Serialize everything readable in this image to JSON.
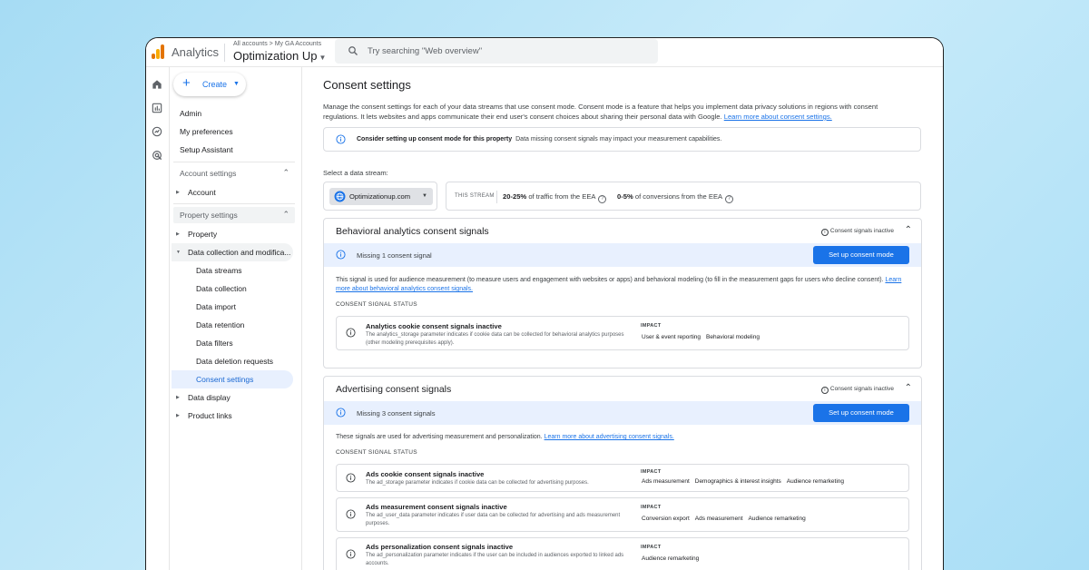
{
  "app": {
    "name": "Analytics",
    "breadcrumb": "All accounts > My GA Accounts",
    "account": "Optimization Up",
    "search_placeholder": "Try searching \"Web overview\""
  },
  "sidebar": {
    "create_label": "Create",
    "top_items": [
      "Admin",
      "My preferences",
      "Setup Assistant"
    ],
    "account_settings": {
      "label": "Account settings",
      "items": [
        "Account"
      ]
    },
    "property_settings": {
      "label": "Property settings",
      "property": "Property",
      "data_collection": "Data collection and modifica...",
      "sub_items": [
        "Data streams",
        "Data collection",
        "Data import",
        "Data retention",
        "Data filters",
        "Data deletion requests",
        "Consent settings"
      ],
      "data_display": "Data display",
      "product_links": "Product links"
    }
  },
  "main": {
    "title": "Consent settings",
    "description": "Manage the consent settings for each of your data streams that use consent mode. Consent mode is a feature that helps you implement data privacy solutions in regions with consent regulations. It lets websites and apps communicate their end user's consent choices about sharing their personal data with Google.",
    "description_link": "Learn more about consent settings.",
    "notice_bold": "Consider setting up consent mode for this property",
    "notice_text": "Data missing consent signals may impact your measurement capabilities.",
    "select_label": "Select a data stream:",
    "stream": "Optimizationup.com",
    "this_stream_label": "THIS STREAM",
    "stat1_bold": "20-25%",
    "stat1_text": "of traffic from the EEA",
    "stat2_bold": "0-5%",
    "stat2_text": "of conversions from the EEA"
  },
  "behavioral": {
    "title": "Behavioral analytics consent signals",
    "status": "Consent signals inactive",
    "missing": "Missing 1 consent signal",
    "button": "Set up consent mode",
    "desc": "This signal is used for audience measurement (to measure users and engagement with websites or apps) and behavioral modeling (to fill in the measurement gaps for users who decline consent).",
    "desc_link": "Learn more about behavioral analytics consent signals.",
    "cs_label": "CONSENT SIGNAL STATUS",
    "signal": {
      "title": "Analytics cookie consent signals inactive",
      "desc": "The analytics_storage parameter indicates if cookie data can be collected for behavioral analytics purposes (other modeling prerequisites apply).",
      "impact_label": "IMPACT",
      "tags": [
        "User & event reporting",
        "Behavioral modeling"
      ]
    }
  },
  "advertising": {
    "title": "Advertising consent signals",
    "status": "Consent signals inactive",
    "missing": "Missing 3 consent signals",
    "button": "Set up consent mode",
    "desc": "These signals are used for advertising measurement and personalization.",
    "desc_link": "Learn more about advertising consent signals.",
    "cs_label": "CONSENT SIGNAL STATUS",
    "signals": [
      {
        "title": "Ads cookie consent signals inactive",
        "desc": "The ad_storage parameter indicates if cookie data can be collected for advertising purposes.",
        "impact_label": "IMPACT",
        "tags": [
          "Ads measurement",
          "Demographics & interest insights",
          "Audience remarketing"
        ]
      },
      {
        "title": "Ads measurement consent signals inactive",
        "desc": "The ad_user_data parameter indicates if user data can be collected for advertising and ads measurement purposes.",
        "impact_label": "IMPACT",
        "tags": [
          "Conversion export",
          "Ads measurement",
          "Audience remarketing"
        ]
      },
      {
        "title": "Ads personalization consent signals inactive",
        "desc": "The ad_personalization parameter indicates if the user can be included in audiences exported to linked ads accounts.",
        "impact_label": "IMPACT",
        "tags": [
          "Audience remarketing"
        ]
      }
    ]
  },
  "colors": {
    "accent": "#1a73e8",
    "banner": "#e8f0fe",
    "selected_nav": "#e8f0fe"
  }
}
